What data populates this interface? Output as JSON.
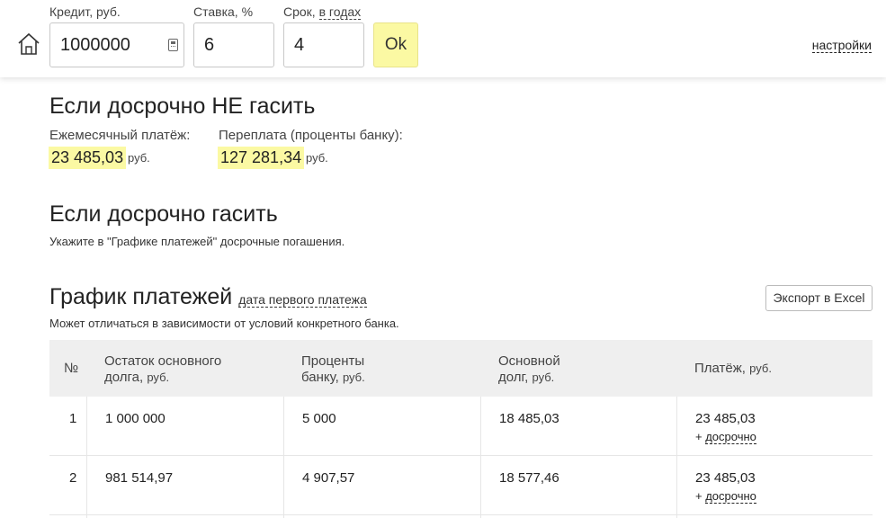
{
  "header": {
    "credit_label": "Кредит, руб.",
    "credit_value": "1000000",
    "rate_label": "Ставка, %",
    "rate_value": "6",
    "term_label": "Срок,",
    "term_unit_link": "в годах",
    "term_value": "4",
    "ok_label": "Ok",
    "settings_link": "настройки"
  },
  "no_early": {
    "title": "Если досрочно НЕ гасить",
    "monthly_label": "Ежемесячный платёж:",
    "monthly_value": "23 485,03",
    "monthly_unit": "руб.",
    "overpay_label": "Переплата (проценты банку):",
    "overpay_value": "127 281,34",
    "overpay_unit": "руб."
  },
  "early": {
    "title": "Если досрочно гасить",
    "hint": "Укажите в \"Графике платежей\" досрочные погашения."
  },
  "schedule": {
    "title": "График платежей",
    "first_date_link": "дата первого платежа",
    "export_button": "Экспорт в Excel",
    "note": "Может отличаться в зависимости от условий конкретного банка.",
    "columns": {
      "num": "№",
      "balance_1": "Остаток основного",
      "balance_2": "долга,",
      "balance_unit": "руб.",
      "interest_1": "Проценты",
      "interest_2": "банку,",
      "interest_unit": "руб.",
      "principal_1": "Основной",
      "principal_2": "долг,",
      "principal_unit": "руб.",
      "payment": "Платёж,",
      "payment_unit": "руб."
    },
    "rows": [
      {
        "num": "1",
        "balance": "1 000 000",
        "interest": "5 000",
        "principal": "18 485,03",
        "payment": "23 485,03",
        "early_link": "досрочно"
      },
      {
        "num": "2",
        "balance": "981 514,97",
        "interest": "4 907,57",
        "principal": "18 577,46",
        "payment": "23 485,03",
        "early_link": "досрочно"
      }
    ],
    "early_prefix": "+"
  }
}
